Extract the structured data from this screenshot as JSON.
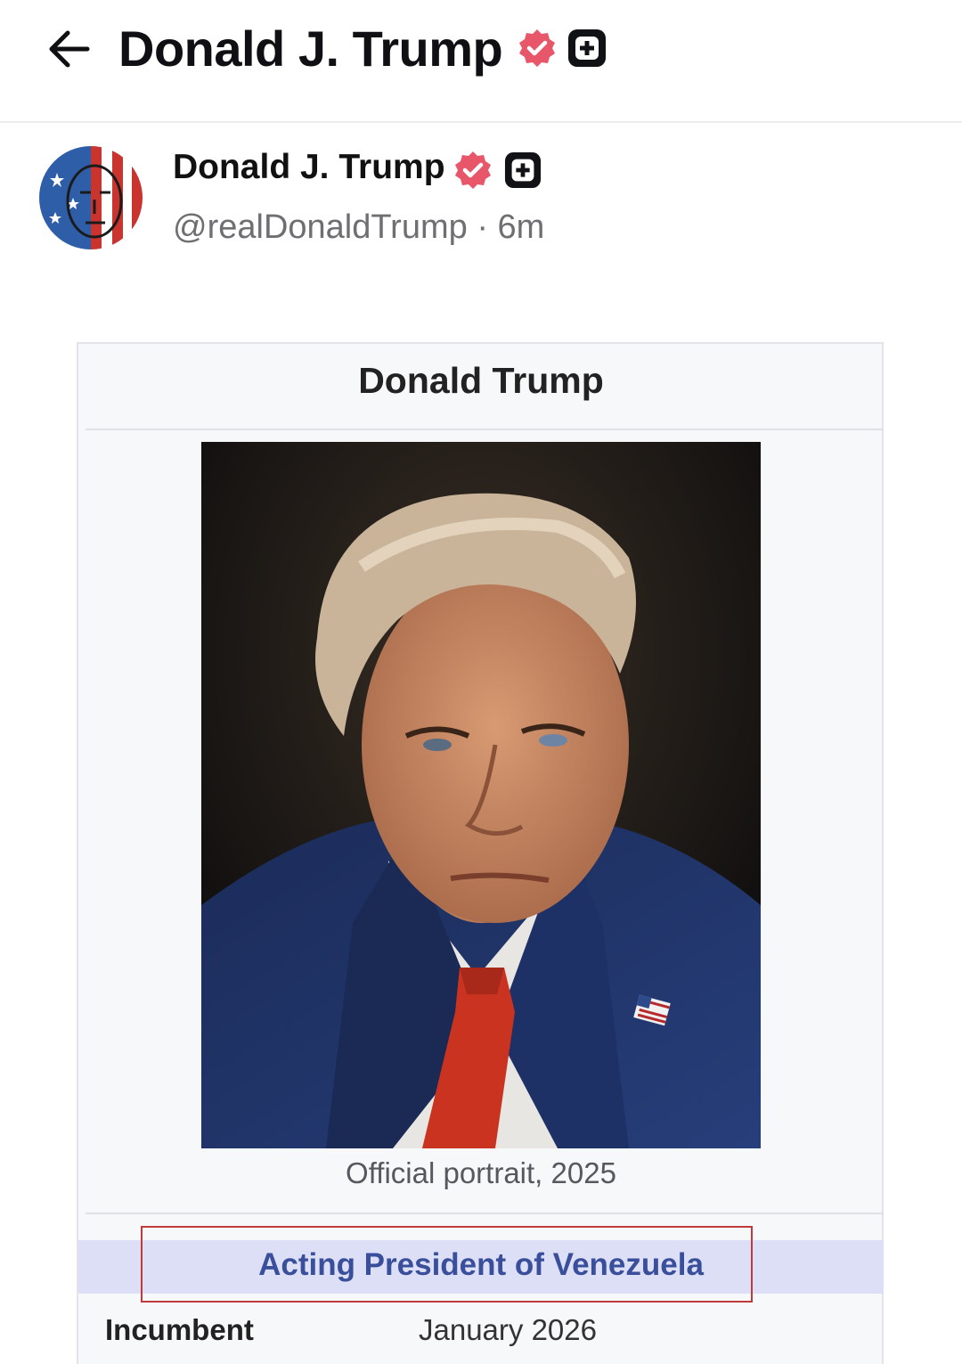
{
  "header": {
    "title": "Donald J. Trump"
  },
  "post": {
    "author_name": "Donald J. Trump",
    "handle": "@realDonaldTrump",
    "separator": "·",
    "time": "6m",
    "avatar_icon": "flag-painted-face-avatar"
  },
  "infobox": {
    "title": "Donald Trump",
    "caption": "Official portrait, 2025",
    "office_title": "Acting President of Venezuela",
    "row": {
      "label": "Incumbent",
      "value": "January 2026"
    }
  },
  "colors": {
    "verified_badge": "#e8566a",
    "office_band": "#dcdff5",
    "office_text": "#3a4f9c",
    "highlight_border": "#c0393b"
  }
}
